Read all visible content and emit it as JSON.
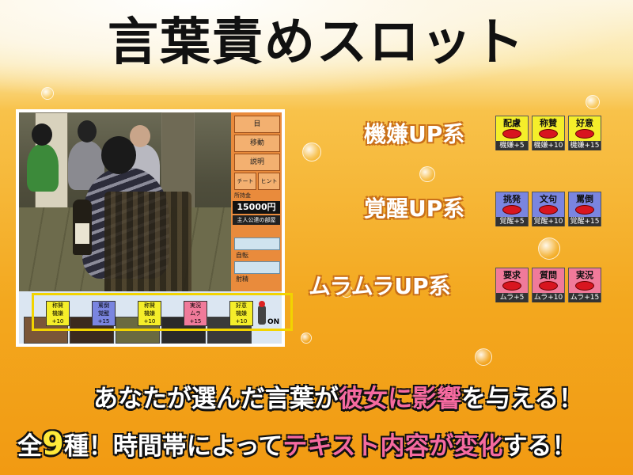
{
  "title": "言葉責めスロット",
  "game": {
    "side_buttons": [
      "目",
      "移動",
      "説明",
      "ヒント",
      "チート"
    ],
    "money_label": "所持金",
    "money": "15000円",
    "room": "主人公達の部屋",
    "gauges": [
      "自転",
      "射精"
    ],
    "reel_tiles": [
      {
        "word": "称賛",
        "value": "機嫌+10",
        "color": "yellow"
      },
      {
        "word": "罵倒",
        "value": "覚醒+15",
        "color": "blue"
      },
      {
        "word": "称賛",
        "value": "機嫌+10",
        "color": "yellow"
      },
      {
        "word": "実況",
        "value": "ムラ+15",
        "color": "pink"
      },
      {
        "word": "好意",
        "value": "機嫌+10",
        "color": "yellow"
      }
    ],
    "on_label": "ON"
  },
  "categories": [
    {
      "label": "機嫌UP系",
      "tiles": [
        {
          "word": "配慮",
          "value": "機嫌+5"
        },
        {
          "word": "称賛",
          "value": "機嫌+10"
        },
        {
          "word": "好意",
          "value": "機嫌+15"
        }
      ]
    },
    {
      "label": "覚醒UP系",
      "tiles": [
        {
          "word": "挑発",
          "value": "覚醒+5"
        },
        {
          "word": "文句",
          "value": "覚醒+10"
        },
        {
          "word": "罵倒",
          "value": "覚醒+15"
        }
      ]
    },
    {
      "label": "ムラムラUP系",
      "tiles": [
        {
          "word": "要求",
          "value": "ムラ+5"
        },
        {
          "word": "質問",
          "value": "ムラ+10"
        },
        {
          "word": "実況",
          "value": "ムラ+15"
        }
      ]
    }
  ],
  "bottom": {
    "line1_a": "あなたが選んだ言葉が",
    "line1_b": "彼女に影響",
    "line1_c": "を与える！",
    "line2_a": "全",
    "line2_b": "9",
    "line2_c": "種！時間帯によって",
    "line2_d": "テキスト内容が変化",
    "line2_e": "する！"
  },
  "colors": {
    "yellow_tile": "#f5ee2a",
    "blue_tile": "#7a85e0",
    "pink_tile": "#f07a9a",
    "highlight": "#f56aa0",
    "accent_yellow": "#ffe93a"
  }
}
